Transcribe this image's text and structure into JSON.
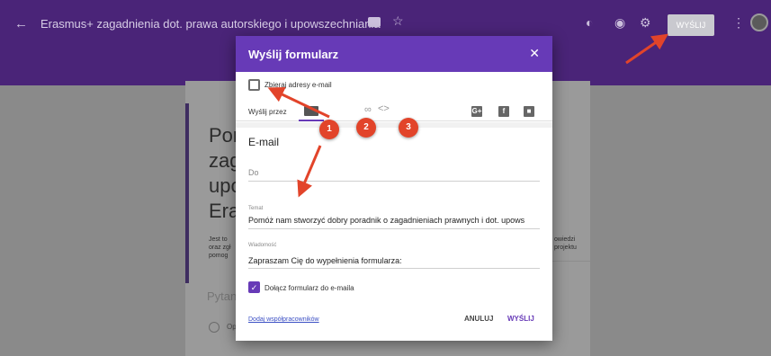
{
  "topbar": {
    "back_icon": "←",
    "title": "Erasmus+ zagadnienia dot. prawa autorskiego i upowszechniania",
    "send_button": "WYŚLIJ",
    "star_icon": "☆",
    "palette_icon": "◐",
    "preview_icon": "◉",
    "settings_icon": "⚙",
    "more_icon": "⋮",
    "color_primary": "#4a2478"
  },
  "background_form": {
    "title_lines": [
      "Por",
      "zag",
      "upo",
      "Era"
    ],
    "desc_left": [
      "Jest to",
      "oraz zgł",
      "pomog"
    ],
    "desc_right": [
      "owiedzi",
      "projektu"
    ],
    "question": "Pytan",
    "option": "Op"
  },
  "dialog": {
    "title": "Wyślij formularz",
    "close_icon": "✕",
    "collect_emails_label": "Zbieraj adresy e-mail",
    "collect_emails_checked": false,
    "send_via_label": "Wyślij przez",
    "tabs": {
      "link_icon": "∞",
      "embed_icon": "<>"
    },
    "social": [
      "G+",
      "f",
      "■"
    ],
    "section_title": "E-mail",
    "to_placeholder": "Do",
    "subject_label": "Temat",
    "subject_value": "Pomóż nam stworzyć dobry poradnik o zagadnieniach prawnych i dot. upows",
    "message_label": "Wiadomość",
    "message_value": "Zapraszam Cię do wypełnienia formularza:",
    "include_form_label": "Dołącz formularz do e-maila",
    "include_form_checked": true,
    "check_mark": "✓",
    "add_collaborators_link": "Dodaj współpracowników",
    "cancel_button": "ANULUJ",
    "send_button": "WYŚLIJ",
    "accent_color": "#673ab7"
  },
  "annotations": {
    "markers": [
      "1",
      "2",
      "3"
    ],
    "color": "#e2442a"
  }
}
